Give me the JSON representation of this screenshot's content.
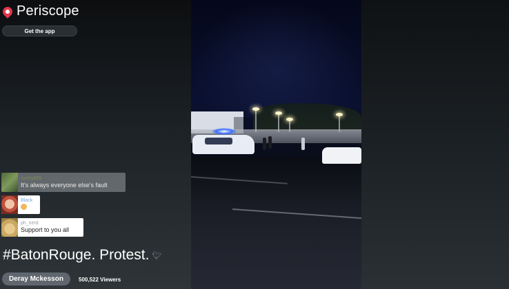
{
  "app": {
    "name": "Periscope",
    "get_app_label": "Get the app"
  },
  "comments": [
    {
      "user": "sunny865",
      "text": "It's always everyone else's fault"
    },
    {
      "user": "Black",
      "text": ""
    },
    {
      "user": "ph_nerd",
      "text": "Support to you all"
    }
  ],
  "broadcast": {
    "title": "#BatonRouge. Protest.",
    "host": "Deray Mckesson",
    "viewers": "500,522 Viewers"
  },
  "colors": {
    "brand": "#e0374d",
    "background": "#23272b"
  },
  "icons": {
    "logo": "periscope-pin-icon",
    "share": "twitter-bird-icon"
  }
}
